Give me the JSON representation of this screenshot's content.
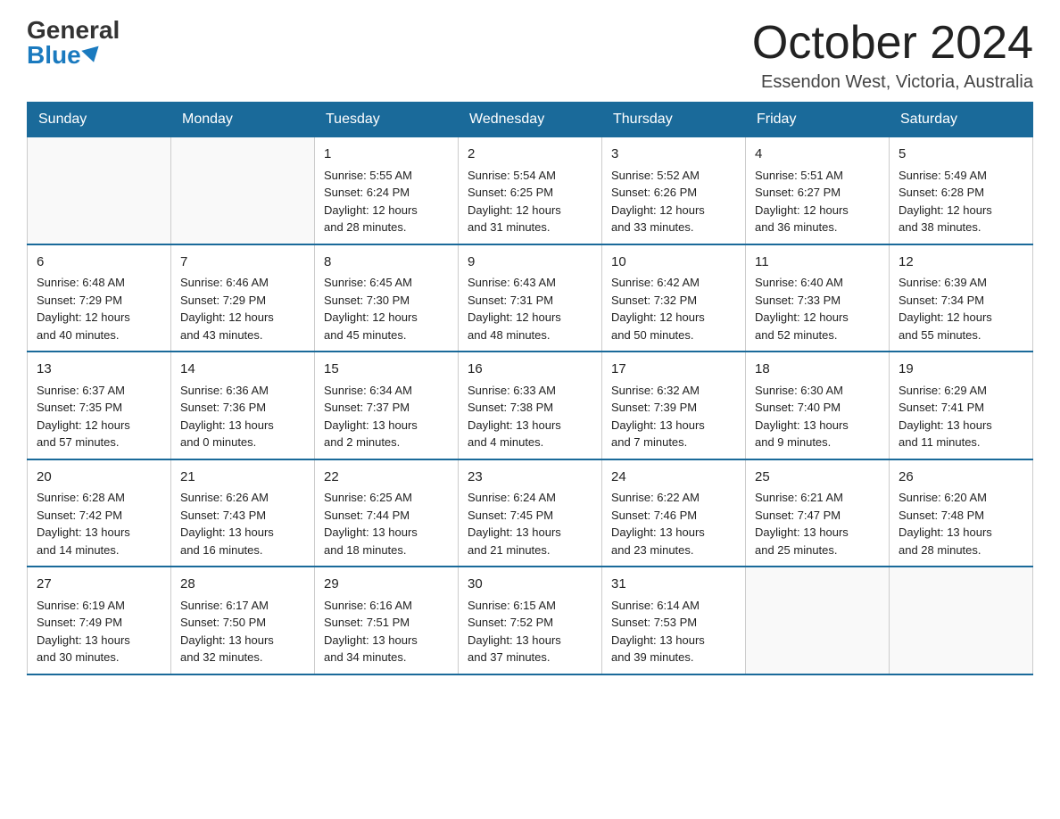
{
  "header": {
    "logo_general": "General",
    "logo_blue": "Blue",
    "month_title": "October 2024",
    "location": "Essendon West, Victoria, Australia"
  },
  "days_of_week": [
    "Sunday",
    "Monday",
    "Tuesday",
    "Wednesday",
    "Thursday",
    "Friday",
    "Saturday"
  ],
  "weeks": [
    [
      {
        "day": "",
        "info": ""
      },
      {
        "day": "",
        "info": ""
      },
      {
        "day": "1",
        "info": "Sunrise: 5:55 AM\nSunset: 6:24 PM\nDaylight: 12 hours\nand 28 minutes."
      },
      {
        "day": "2",
        "info": "Sunrise: 5:54 AM\nSunset: 6:25 PM\nDaylight: 12 hours\nand 31 minutes."
      },
      {
        "day": "3",
        "info": "Sunrise: 5:52 AM\nSunset: 6:26 PM\nDaylight: 12 hours\nand 33 minutes."
      },
      {
        "day": "4",
        "info": "Sunrise: 5:51 AM\nSunset: 6:27 PM\nDaylight: 12 hours\nand 36 minutes."
      },
      {
        "day": "5",
        "info": "Sunrise: 5:49 AM\nSunset: 6:28 PM\nDaylight: 12 hours\nand 38 minutes."
      }
    ],
    [
      {
        "day": "6",
        "info": "Sunrise: 6:48 AM\nSunset: 7:29 PM\nDaylight: 12 hours\nand 40 minutes."
      },
      {
        "day": "7",
        "info": "Sunrise: 6:46 AM\nSunset: 7:29 PM\nDaylight: 12 hours\nand 43 minutes."
      },
      {
        "day": "8",
        "info": "Sunrise: 6:45 AM\nSunset: 7:30 PM\nDaylight: 12 hours\nand 45 minutes."
      },
      {
        "day": "9",
        "info": "Sunrise: 6:43 AM\nSunset: 7:31 PM\nDaylight: 12 hours\nand 48 minutes."
      },
      {
        "day": "10",
        "info": "Sunrise: 6:42 AM\nSunset: 7:32 PM\nDaylight: 12 hours\nand 50 minutes."
      },
      {
        "day": "11",
        "info": "Sunrise: 6:40 AM\nSunset: 7:33 PM\nDaylight: 12 hours\nand 52 minutes."
      },
      {
        "day": "12",
        "info": "Sunrise: 6:39 AM\nSunset: 7:34 PM\nDaylight: 12 hours\nand 55 minutes."
      }
    ],
    [
      {
        "day": "13",
        "info": "Sunrise: 6:37 AM\nSunset: 7:35 PM\nDaylight: 12 hours\nand 57 minutes."
      },
      {
        "day": "14",
        "info": "Sunrise: 6:36 AM\nSunset: 7:36 PM\nDaylight: 13 hours\nand 0 minutes."
      },
      {
        "day": "15",
        "info": "Sunrise: 6:34 AM\nSunset: 7:37 PM\nDaylight: 13 hours\nand 2 minutes."
      },
      {
        "day": "16",
        "info": "Sunrise: 6:33 AM\nSunset: 7:38 PM\nDaylight: 13 hours\nand 4 minutes."
      },
      {
        "day": "17",
        "info": "Sunrise: 6:32 AM\nSunset: 7:39 PM\nDaylight: 13 hours\nand 7 minutes."
      },
      {
        "day": "18",
        "info": "Sunrise: 6:30 AM\nSunset: 7:40 PM\nDaylight: 13 hours\nand 9 minutes."
      },
      {
        "day": "19",
        "info": "Sunrise: 6:29 AM\nSunset: 7:41 PM\nDaylight: 13 hours\nand 11 minutes."
      }
    ],
    [
      {
        "day": "20",
        "info": "Sunrise: 6:28 AM\nSunset: 7:42 PM\nDaylight: 13 hours\nand 14 minutes."
      },
      {
        "day": "21",
        "info": "Sunrise: 6:26 AM\nSunset: 7:43 PM\nDaylight: 13 hours\nand 16 minutes."
      },
      {
        "day": "22",
        "info": "Sunrise: 6:25 AM\nSunset: 7:44 PM\nDaylight: 13 hours\nand 18 minutes."
      },
      {
        "day": "23",
        "info": "Sunrise: 6:24 AM\nSunset: 7:45 PM\nDaylight: 13 hours\nand 21 minutes."
      },
      {
        "day": "24",
        "info": "Sunrise: 6:22 AM\nSunset: 7:46 PM\nDaylight: 13 hours\nand 23 minutes."
      },
      {
        "day": "25",
        "info": "Sunrise: 6:21 AM\nSunset: 7:47 PM\nDaylight: 13 hours\nand 25 minutes."
      },
      {
        "day": "26",
        "info": "Sunrise: 6:20 AM\nSunset: 7:48 PM\nDaylight: 13 hours\nand 28 minutes."
      }
    ],
    [
      {
        "day": "27",
        "info": "Sunrise: 6:19 AM\nSunset: 7:49 PM\nDaylight: 13 hours\nand 30 minutes."
      },
      {
        "day": "28",
        "info": "Sunrise: 6:17 AM\nSunset: 7:50 PM\nDaylight: 13 hours\nand 32 minutes."
      },
      {
        "day": "29",
        "info": "Sunrise: 6:16 AM\nSunset: 7:51 PM\nDaylight: 13 hours\nand 34 minutes."
      },
      {
        "day": "30",
        "info": "Sunrise: 6:15 AM\nSunset: 7:52 PM\nDaylight: 13 hours\nand 37 minutes."
      },
      {
        "day": "31",
        "info": "Sunrise: 6:14 AM\nSunset: 7:53 PM\nDaylight: 13 hours\nand 39 minutes."
      },
      {
        "day": "",
        "info": ""
      },
      {
        "day": "",
        "info": ""
      }
    ]
  ]
}
